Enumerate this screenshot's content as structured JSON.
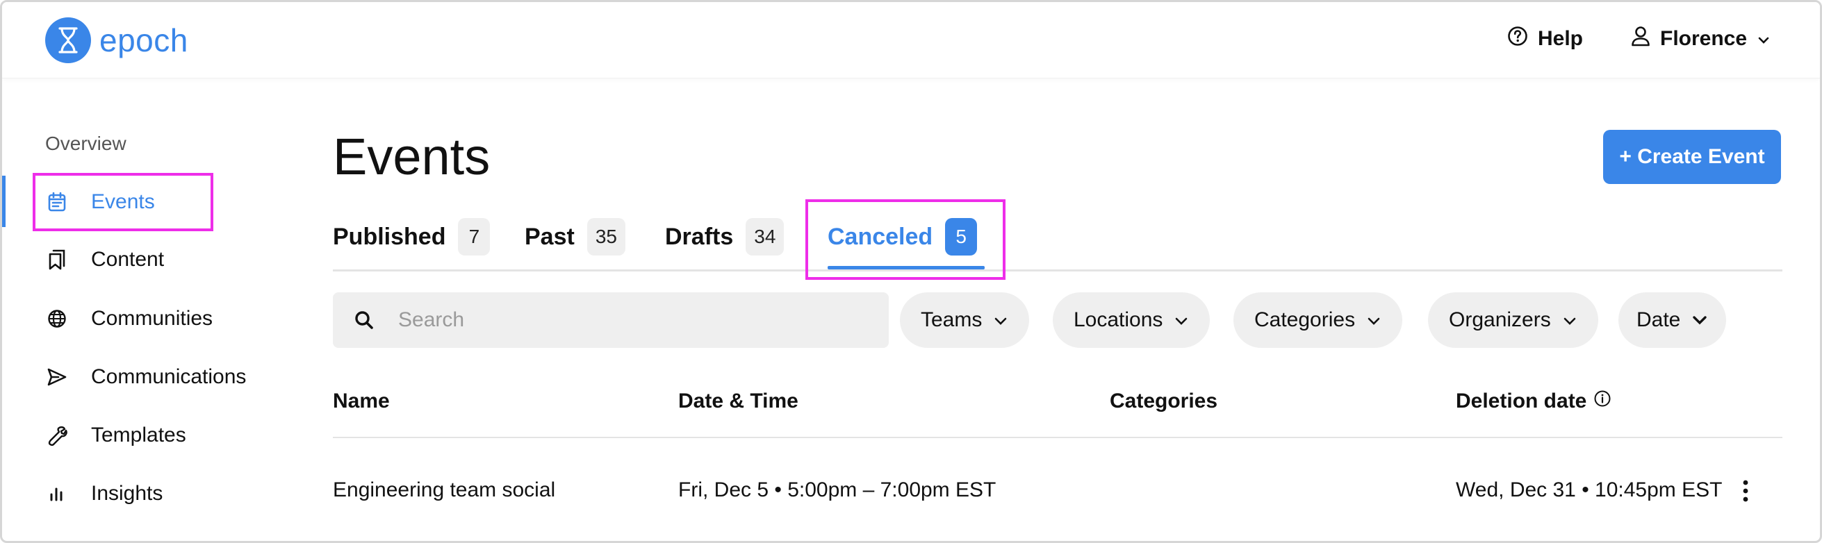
{
  "header": {
    "app_name": "epoch",
    "help_label": "Help",
    "user_name": "Florence",
    "brand_color": "#3a86e8"
  },
  "sidebar": {
    "section_label": "Overview",
    "items": [
      {
        "label": "Events",
        "icon": "calendar-icon",
        "active": true
      },
      {
        "label": "Content",
        "icon": "bookmark-icon"
      },
      {
        "label": "Communities",
        "icon": "globe-icon"
      },
      {
        "label": "Communications",
        "icon": "send-icon"
      },
      {
        "label": "Templates",
        "icon": "wrench-icon"
      },
      {
        "label": "Insights",
        "icon": "bar-chart-icon"
      }
    ]
  },
  "main": {
    "title": "Events",
    "create_button": "+ Create Event",
    "tabs": [
      {
        "label": "Published",
        "count": "7"
      },
      {
        "label": "Past",
        "count": "35"
      },
      {
        "label": "Drafts",
        "count": "34"
      },
      {
        "label": "Canceled",
        "count": "5",
        "active": true
      }
    ],
    "search": {
      "placeholder": "Search",
      "value": ""
    },
    "filters": [
      "Teams",
      "Locations",
      "Categories",
      "Organizers",
      "Date"
    ],
    "table": {
      "columns": [
        "Name",
        "Date & Time",
        "Categories",
        "Deletion date"
      ],
      "rows": [
        {
          "name": "Engineering team social",
          "datetime": "Fri, Dec 5 • 5:00pm – 7:00pm EST",
          "categories": "",
          "deletion_date": "Wed, Dec 31 • 10:45pm EST"
        }
      ]
    }
  },
  "highlight_color": "#ee2ee9"
}
